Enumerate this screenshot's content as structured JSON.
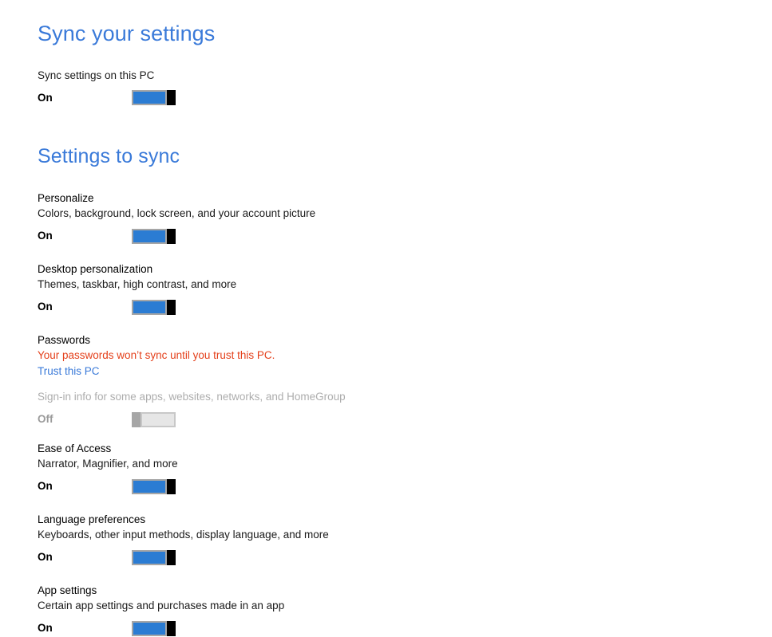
{
  "page": {
    "title": "Sync your settings",
    "section_title": "Settings to sync"
  },
  "intro": {
    "label": "Sync settings on this PC",
    "toggle_state": "On"
  },
  "settings": [
    {
      "name": "Personalize",
      "description": "Colors, background, lock screen, and your account picture",
      "toggle_state": "On"
    },
    {
      "name": "Desktop personalization",
      "description": "Themes, taskbar, high contrast, and more",
      "toggle_state": "On"
    },
    {
      "name": "Passwords",
      "warning": "Your passwords won’t sync until you trust this PC.",
      "link": "Trust this PC",
      "sub_description": "Sign-in info for some apps, websites, networks, and HomeGroup",
      "toggle_state": "Off"
    },
    {
      "name": "Ease of Access",
      "description": "Narrator, Magnifier, and more",
      "toggle_state": "On"
    },
    {
      "name": "Language preferences",
      "description": "Keyboards, other input methods, display language, and more",
      "toggle_state": "On"
    },
    {
      "name": "App settings",
      "description": "Certain app settings and purchases made in an app",
      "toggle_state": "On"
    }
  ],
  "colors": {
    "heading_blue": "#3a7ad9",
    "link_blue": "#3a7ad9",
    "warning_orange": "#e4401b",
    "toggle_on_fill": "#2b7cd3",
    "toggle_border": "#a6a6a6",
    "toggle_thumb": "#000000",
    "disabled_text": "#adadad",
    "background": "#ffffff"
  }
}
